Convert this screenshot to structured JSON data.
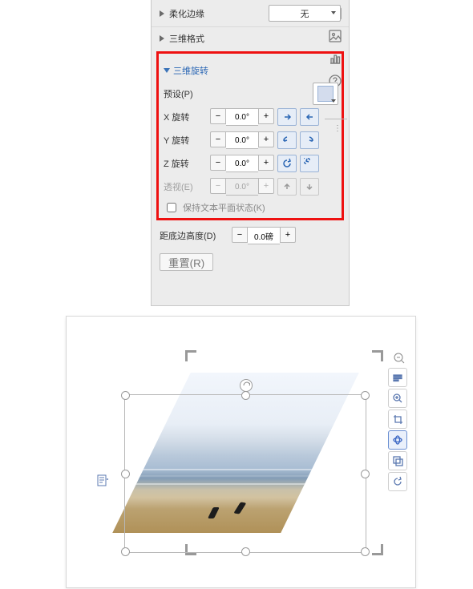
{
  "sections": {
    "soften": "柔化边缘",
    "soften_value": "无",
    "format3d": "三维格式",
    "rotation3d": "三维旋转"
  },
  "preset_label": "预设(P)",
  "rot": {
    "x": {
      "label": "X 旋转",
      "value": "0.0°"
    },
    "y": {
      "label": "Y 旋转",
      "value": "0.0°"
    },
    "z": {
      "label": "Z 旋转",
      "value": "0.0°"
    },
    "persp": {
      "label": "透视(E)",
      "value": "0.0°"
    }
  },
  "keep_flat": "保持文本平面状态(K)",
  "ground": {
    "label": "距底边高度(D)",
    "value": "0.0磅"
  },
  "reset": "重置(R)",
  "icons": {
    "save": "save-icon",
    "image": "image-icon",
    "chart": "chart-icon",
    "help": "help-icon",
    "minus": "−",
    "plus": "+",
    "rotx_ccw": "rot-x-ccw",
    "rotx_cw": "rot-x-cw",
    "roty_ccw": "rot-y-ccw",
    "roty_cw": "rot-y-cw",
    "rotz_ccw": "rot-z-ccw",
    "rotz_cw": "rot-z-cw",
    "up": "up-icon",
    "down": "down-icon"
  },
  "tools": {
    "zoomout": "zoom-out-icon",
    "items": [
      "text-icon",
      "zoom-icon",
      "crop-icon",
      "rotate-3d-icon",
      "layers-icon",
      "reset-icon"
    ]
  }
}
